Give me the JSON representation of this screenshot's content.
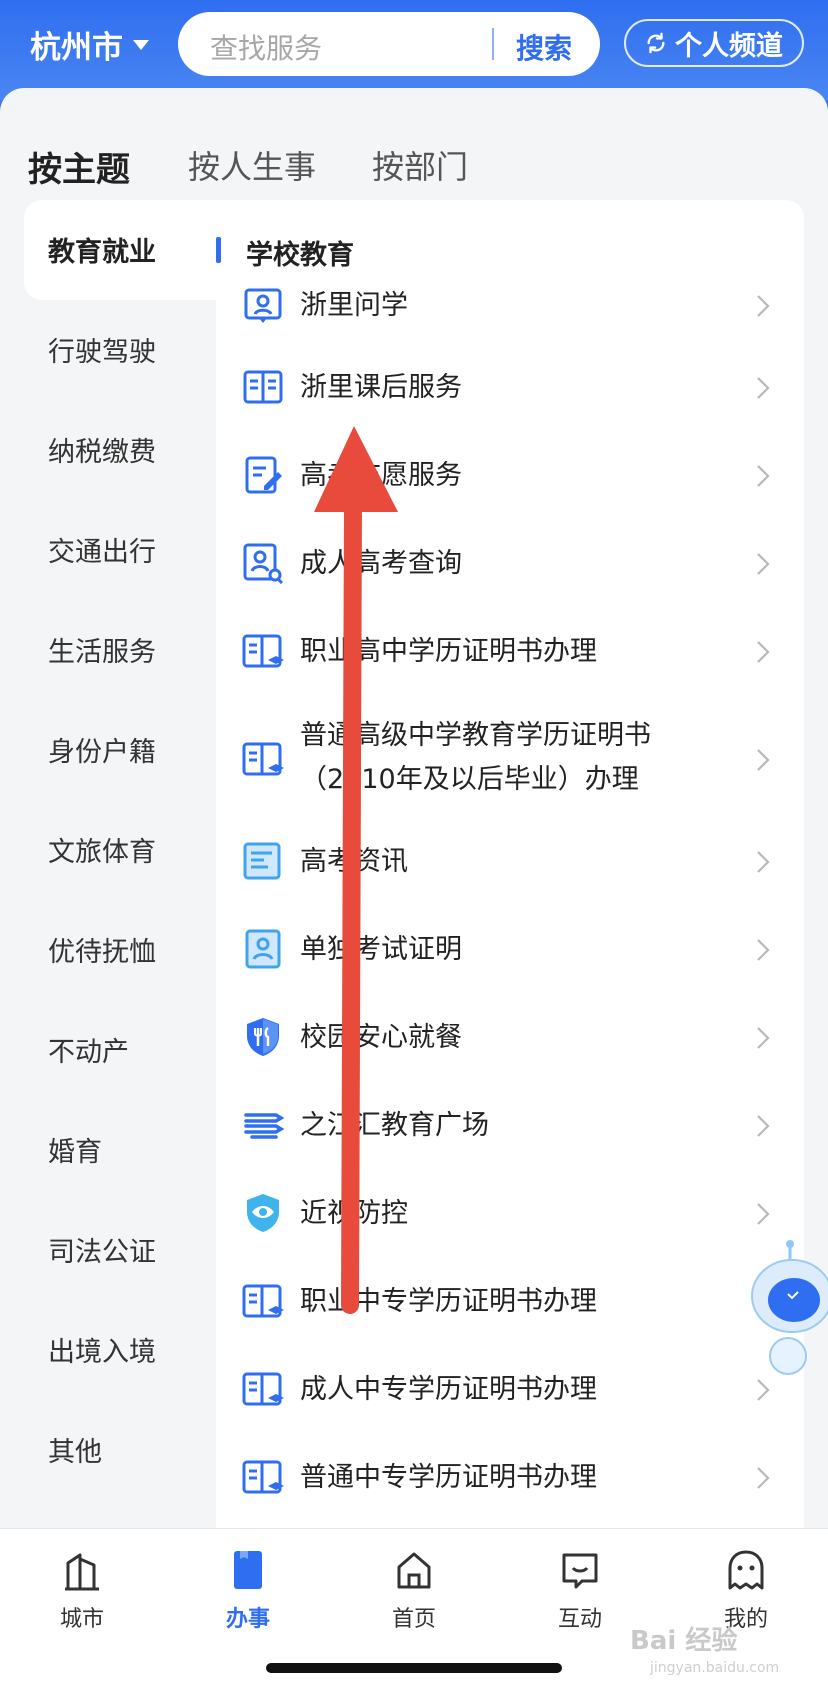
{
  "header": {
    "city": "杭州市",
    "search_placeholder": "查找服务",
    "search_button": "搜索",
    "personal_channel": "个人频道"
  },
  "tabs": [
    {
      "label": "按主题",
      "active": true
    },
    {
      "label": "按人生事",
      "active": false
    },
    {
      "label": "按部门",
      "active": false
    }
  ],
  "sidebar": {
    "items": [
      {
        "label": "教育就业",
        "active": true
      },
      {
        "label": "行驶驾驶"
      },
      {
        "label": "纳税缴费"
      },
      {
        "label": "交通出行"
      },
      {
        "label": "生活服务"
      },
      {
        "label": "身份户籍"
      },
      {
        "label": "文旅体育"
      },
      {
        "label": "优待抚恤"
      },
      {
        "label": "不动产"
      },
      {
        "label": "婚育"
      },
      {
        "label": "司法公证"
      },
      {
        "label": "出境入境"
      },
      {
        "label": "其他"
      }
    ]
  },
  "content": {
    "section_title": "学校教育",
    "services": [
      {
        "label": "浙里问学",
        "icon": "badge-person-icon"
      },
      {
        "label": "浙里课后服务",
        "icon": "book-icon"
      },
      {
        "label": "高考志愿服务",
        "icon": "edit-document-icon"
      },
      {
        "label": "成人高考查询",
        "icon": "person-search-icon"
      },
      {
        "label": "职业高中学历证明书办理",
        "icon": "certificate-book-icon"
      },
      {
        "label": "普通高级中学教育学历证明书（2010年及以后毕业）办理",
        "icon": "certificate-book-icon"
      },
      {
        "label": "高考资讯",
        "icon": "news-icon"
      },
      {
        "label": "单独考试证明",
        "icon": "id-card-icon"
      },
      {
        "label": "校园安心就餐",
        "icon": "shield-fork-icon"
      },
      {
        "label": "之江汇教育广场",
        "icon": "waves-icon"
      },
      {
        "label": "近视防控",
        "icon": "shield-eye-icon"
      },
      {
        "label": "职业中专学历证明书办理",
        "icon": "certificate-book-icon"
      },
      {
        "label": "成人中专学历证明书办理",
        "icon": "certificate-book-icon"
      },
      {
        "label": "普通中专学历证明书办理",
        "icon": "certificate-book-icon"
      }
    ]
  },
  "bottom_nav": [
    {
      "label": "城市",
      "icon": "city-icon",
      "active": false
    },
    {
      "label": "办事",
      "icon": "service-icon",
      "active": true
    },
    {
      "label": "首页",
      "icon": "home-icon",
      "active": false
    },
    {
      "label": "互动",
      "icon": "chat-icon",
      "active": false
    },
    {
      "label": "我的",
      "icon": "profile-icon",
      "active": false
    }
  ],
  "watermark": "Bai 经验",
  "watermark_sub": "jingyan.baidu.com",
  "colors": {
    "brand_blue": "#2f6ef0",
    "annotation_arrow": "#e84a3c"
  }
}
